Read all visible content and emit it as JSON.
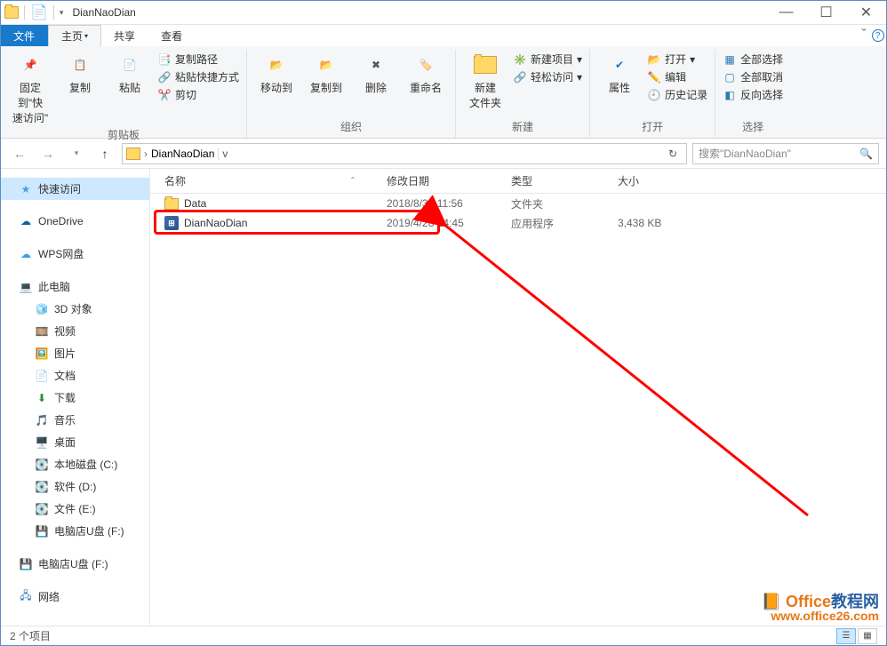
{
  "title": "DianNaoDian",
  "tabs": {
    "file": "文件",
    "home": "主页",
    "share": "共享",
    "view": "查看"
  },
  "ribbon": {
    "pin": "固定到\"快\n速访问\"",
    "copy": "复制",
    "paste": "粘贴",
    "copypath": "复制路径",
    "pasteshortcut": "粘贴快捷方式",
    "cut": "剪切",
    "g_clipboard": "剪贴板",
    "moveto": "移动到",
    "copyto": "复制到",
    "delete": "删除",
    "rename": "重命名",
    "g_organize": "组织",
    "newfolder": "新建\n文件夹",
    "newitem": "新建项目",
    "easyaccess": "轻松访问",
    "g_new": "新建",
    "properties": "属性",
    "open": "打开",
    "edit": "编辑",
    "history": "历史记录",
    "g_open": "打开",
    "selectall": "全部选择",
    "selectnone": "全部取消",
    "invert": "反向选择",
    "g_select": "选择"
  },
  "address": {
    "path": "DianNaoDian"
  },
  "search": {
    "placeholder": "搜索\"DianNaoDian\""
  },
  "columns": {
    "name": "名称",
    "date": "修改日期",
    "type": "类型",
    "size": "大小"
  },
  "rows": [
    {
      "icon": "folder",
      "name": "Data",
      "date": "2018/8/30 11:56",
      "type": "文件夹",
      "size": ""
    },
    {
      "icon": "exe",
      "name": "DianNaoDian",
      "date": "2019/4/28 14:45",
      "type": "应用程序",
      "size": "3,438 KB"
    }
  ],
  "sidebar": {
    "quick": "快速访问",
    "onedrive": "OneDrive",
    "wps": "WPS网盘",
    "thispc": "此电脑",
    "obj3d": "3D 对象",
    "video": "视频",
    "pictures": "图片",
    "docs": "文档",
    "downloads": "下载",
    "music": "音乐",
    "desktop": "桌面",
    "cdisk": "本地磁盘 (C:)",
    "ddisk": "软件 (D:)",
    "edisk": "文件 (E:)",
    "fdisk": "电脑店U盘 (F:)",
    "fdisk2": "电脑店U盘 (F:)",
    "network": "网络"
  },
  "status": {
    "count": "2 个项目"
  },
  "watermark": {
    "l1a": "Office",
    "l1b": "教程网",
    "l2": "www.office26.com"
  }
}
